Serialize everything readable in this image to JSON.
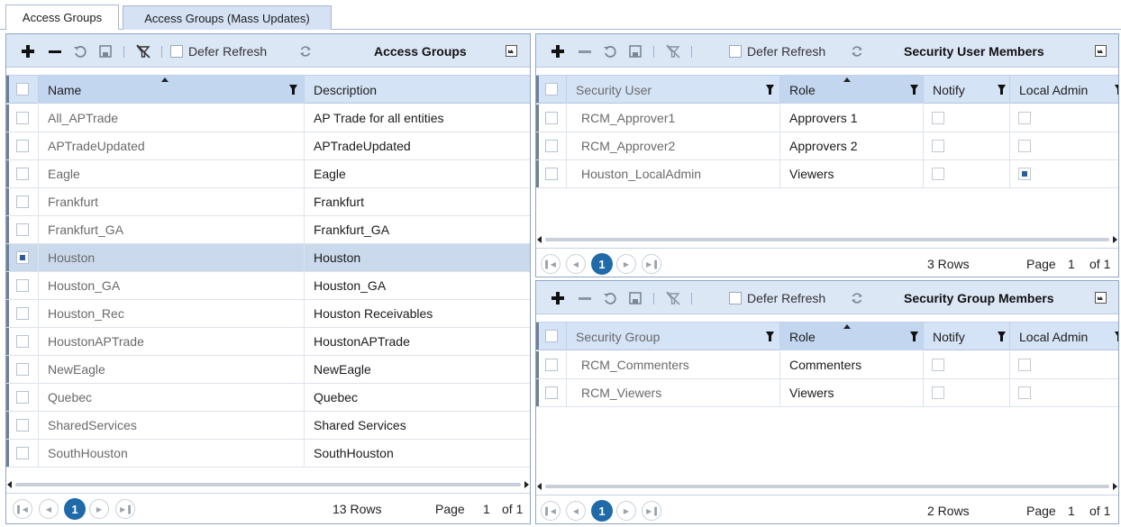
{
  "tabs": [
    {
      "label": "Access Groups",
      "active": true
    },
    {
      "label": "Access Groups (Mass Updates)",
      "active": false
    }
  ],
  "toolbar": {
    "defer_label": "Defer Refresh",
    "icons": [
      "add-icon",
      "remove-icon",
      "undo-icon",
      "save-icon",
      "clear-filter-icon",
      "refresh-icon",
      "expand-icon"
    ]
  },
  "left_panel": {
    "title": "Access Groups",
    "columns": [
      "Name",
      "Description"
    ],
    "rows": [
      {
        "name": "All_APTrade",
        "description": "AP Trade for all entities"
      },
      {
        "name": "APTradeUpdated",
        "description": "APTradeUpdated"
      },
      {
        "name": "Eagle",
        "description": "Eagle"
      },
      {
        "name": "Frankfurt",
        "description": "Frankfurt"
      },
      {
        "name": "Frankfurt_GA",
        "description": "Frankfurt_GA"
      },
      {
        "name": "Houston",
        "description": "Houston"
      },
      {
        "name": "Houston_GA",
        "description": "Houston_GA"
      },
      {
        "name": "Houston_Rec",
        "description": "Houston Receivables"
      },
      {
        "name": "HoustonAPTrade",
        "description": "HoustonAPTrade"
      },
      {
        "name": "NewEagle",
        "description": "NewEagle"
      },
      {
        "name": "Quebec",
        "description": "Quebec"
      },
      {
        "name": "SharedServices",
        "description": "Shared Services"
      },
      {
        "name": "SouthHouston",
        "description": "SouthHouston"
      }
    ],
    "selected_row": "Houston",
    "pager": {
      "current": "1",
      "rows": "13 Rows",
      "page_label": "Page",
      "page": "1",
      "of": "of 1"
    }
  },
  "user_panel": {
    "title": "Security User Members",
    "columns": [
      "Security User",
      "Role",
      "Notify",
      "Local Admin"
    ],
    "rows": [
      {
        "user": "RCM_Approver1",
        "role": "Approvers 1",
        "notify": false,
        "local_admin": false
      },
      {
        "user": "RCM_Approver2",
        "role": "Approvers 2",
        "notify": false,
        "local_admin": false
      },
      {
        "user": "Houston_LocalAdmin",
        "role": "Viewers",
        "notify": false,
        "local_admin": true
      }
    ],
    "pager": {
      "current": "1",
      "rows": "3 Rows",
      "page_label": "Page",
      "page": "1",
      "of": "of 1"
    }
  },
  "group_panel": {
    "title": "Security Group Members",
    "columns": [
      "Security Group",
      "Role",
      "Notify",
      "Local Admin"
    ],
    "rows": [
      {
        "group": "RCM_Commenters",
        "role": "Commenters",
        "notify": false,
        "local_admin": false
      },
      {
        "group": "RCM_Viewers",
        "role": "Viewers",
        "notify": false,
        "local_admin": false
      }
    ],
    "pager": {
      "current": "1",
      "rows": "2 Rows",
      "page_label": "Page",
      "page": "1",
      "of": "of 1"
    }
  },
  "colors": {
    "toolbar_bg": "#dce7f6",
    "header_bg": "#d5e3f6",
    "selected_row": "#cbd9ec",
    "pager_accent": "#1f6aa8"
  }
}
